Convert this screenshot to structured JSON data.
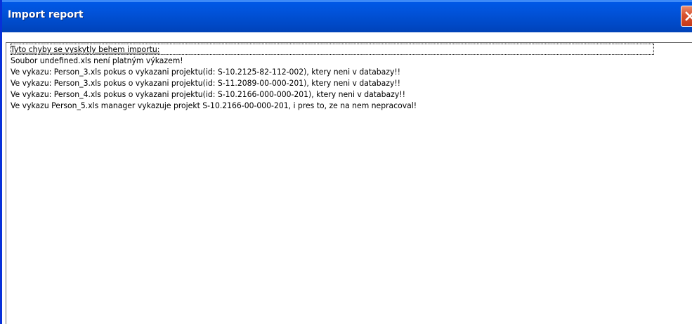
{
  "window": {
    "title": "Import report",
    "accent_color": "#0054e3",
    "close_button_color": "#d9522e"
  },
  "icons": {
    "close": "close-icon"
  },
  "report": {
    "lines": [
      "Tyto chyby se vyskytly behem importu:",
      "Soubor undefined.xls není platným výkazem!",
      "Ve vykazu: Person_3.xls pokus o vykazani projektu(id: S-10.2125-82-112-002), ktery neni v databazy!!",
      "Ve vykazu: Person_3.xls pokus o vykazani projektu(id: S-11.2089-00-000-201), ktery neni v databazy!!",
      "Ve vykazu: Person_4.xls pokus o vykazani projektu(id: S-10.2166-000-000-201), ktery neni v databazy!!",
      "Ve vykazu Person_5.xls manager vykazuje projekt S-10.2166-00-000-201, i pres to, ze na nem nepracoval!"
    ],
    "selected_index": 0
  }
}
